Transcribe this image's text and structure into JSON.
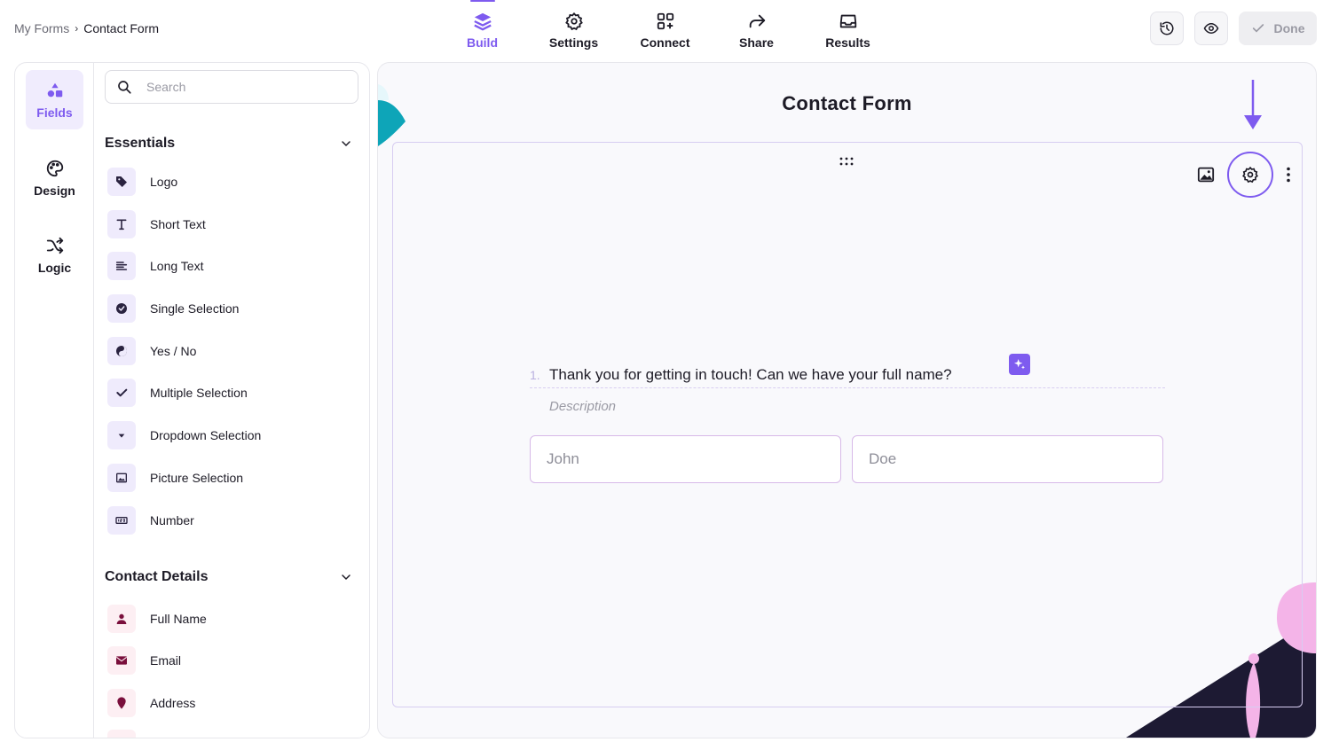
{
  "breadcrumb": {
    "root": "My Forms",
    "separator": "›",
    "current": "Contact Form"
  },
  "topnav": [
    {
      "label": "Build",
      "icon": "layers-icon",
      "active": true
    },
    {
      "label": "Settings",
      "icon": "gear-icon"
    },
    {
      "label": "Connect",
      "icon": "apps-add-icon"
    },
    {
      "label": "Share",
      "icon": "share-arrow-icon"
    },
    {
      "label": "Results",
      "icon": "inbox-icon"
    }
  ],
  "actions": {
    "history_icon": "history-icon",
    "preview_icon": "eye-icon",
    "done_label": "Done"
  },
  "rail": [
    {
      "label": "Fields",
      "icon": "shapes-icon",
      "active": true
    },
    {
      "label": "Design",
      "icon": "palette-icon"
    },
    {
      "label": "Logic",
      "icon": "shuffle-icon"
    }
  ],
  "search": {
    "placeholder": "Search"
  },
  "essentials": {
    "title": "Essentials",
    "items": [
      {
        "label": "Logo",
        "icon": "tag-icon"
      },
      {
        "label": "Short Text",
        "icon": "text-t-icon"
      },
      {
        "label": "Long Text",
        "icon": "align-left-icon"
      },
      {
        "label": "Single Selection",
        "icon": "check-circle-icon"
      },
      {
        "label": "Yes / No",
        "icon": "yin-yang-icon"
      },
      {
        "label": "Multiple Selection",
        "icon": "checkmark-icon"
      },
      {
        "label": "Dropdown Selection",
        "icon": "caret-down-icon"
      },
      {
        "label": "Picture Selection",
        "icon": "image-icon"
      },
      {
        "label": "Number",
        "icon": "number-box-icon"
      }
    ]
  },
  "contact_details": {
    "title": "Contact Details",
    "items": [
      {
        "label": "Full Name",
        "icon": "person-icon"
      },
      {
        "label": "Email",
        "icon": "envelope-icon"
      },
      {
        "label": "Address",
        "icon": "map-pin-icon"
      }
    ]
  },
  "canvas": {
    "form_title": "Contact Form",
    "question": {
      "number": "1.",
      "text": "Thank you for getting in touch! Can we have your full name?",
      "description_placeholder": "Description",
      "first_name_placeholder": "John",
      "last_name_placeholder": "Doe"
    }
  },
  "colors": {
    "accent": "#7e5bef",
    "accent_light": "#efebfc",
    "contact_icon": "#7a0f3c"
  }
}
